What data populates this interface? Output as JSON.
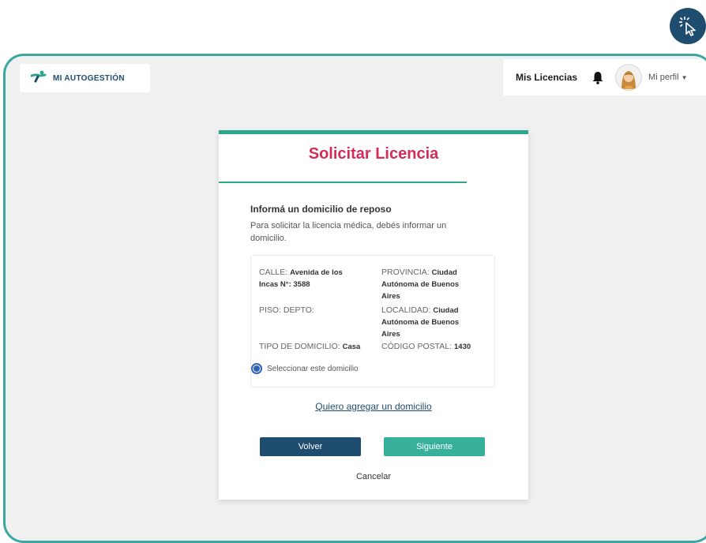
{
  "brand": {
    "name": "MI AUTOGESTIÓN",
    "logo_icon": "runner-logo-icon",
    "color": "#1f4d6f"
  },
  "nav": {
    "licencias_label": "Mis Licencias",
    "profile_label": "Mi perfil",
    "bell_icon": "bell-icon",
    "caret_icon": "caret-down-icon"
  },
  "card": {
    "title": "Solicitar Licencia",
    "section_title": "Informá un domicilio de reposo",
    "section_desc": "Para solicitar la licencia médica, debés informar un domicilio.",
    "address": {
      "calle_label": "CALLE:",
      "calle_value": "Avenida de los Incas N°: 3588",
      "provincia_label": "PROVINCIA:",
      "provincia_value": "Ciudad Autónoma de Buenos Aires",
      "piso_label": "PISO: DEPTO:",
      "localidad_label": "LOCALIDAD:",
      "localidad_value": "Ciudad Autónoma de Buenos Aires",
      "tipo_label": "TIPO DE DOMICILIO:",
      "tipo_value": "Casa",
      "cp_label": "CÓDIGO POSTAL:",
      "cp_value": "1430",
      "select_label": "Seleccionar este domicilio",
      "selected": true
    },
    "add_link": "Quiero agregar un domicilio",
    "back_label": "Volver",
    "next_label": "Siguiente",
    "cancel_label": "Cancelar"
  },
  "colors": {
    "accent": "#d22c57",
    "teal": "#2ba68f",
    "navy": "#1f4d6f",
    "radio": "#2f63b6"
  }
}
